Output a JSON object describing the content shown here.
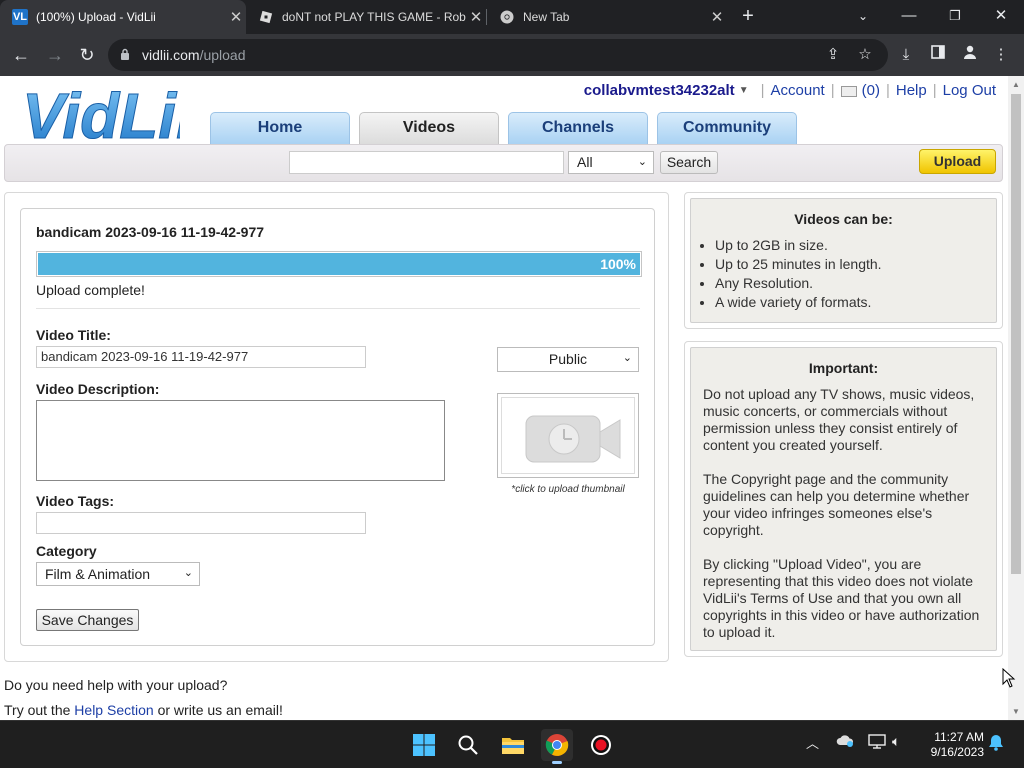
{
  "browser": {
    "tabs": [
      {
        "title": "(100%) Upload - VidLii",
        "favicon": "VL"
      },
      {
        "title": "doNT not PLAY THIS GAME - Rob",
        "favicon": "roblox-icon"
      },
      {
        "title": "New Tab",
        "favicon": "chrome-icon"
      }
    ],
    "url_domain": "vidlii.com",
    "url_path": "/upload"
  },
  "site": {
    "logo_text": "VidLii",
    "username": "collabvmtest34232alt",
    "account": "Account",
    "inbox_count": "(0)",
    "help": "Help",
    "logout": "Log Out",
    "nav": [
      "Home",
      "Videos",
      "Channels",
      "Community"
    ],
    "search_select": "All",
    "search_button": "Search",
    "upload_button": "Upload"
  },
  "upload": {
    "file_name": "bandicam 2023-09-16 11-19-42-977",
    "progress": 100,
    "progress_label": "100%",
    "status": "Upload complete!",
    "title_label": "Video Title:",
    "title_value": "bandicam 2023-09-16 11-19-42-977",
    "privacy": "Public",
    "description_label": "Video Description:",
    "thumbnail_hint": "*click to upload thumbnail",
    "tags_label": "Video Tags:",
    "category_label": "Category",
    "category_value": "Film & Animation",
    "save_button": "Save Changes"
  },
  "sidebar": {
    "videos_title": "Videos can be:",
    "videos_items": [
      "Up to 2GB in size.",
      "Up to 25 minutes in length.",
      "Any Resolution.",
      "A wide variety of formats."
    ],
    "important_title": "Important:",
    "important_paras": [
      "Do not upload any TV shows, music videos, music concerts, or commercials without permission unless they consist entirely of content you created yourself.",
      "The Copyright page and the community guidelines can help you determine whether your video infringes someones else's copyright.",
      "By clicking \"Upload Video\", you are representing that this video does not violate VidLii's Terms of Use and that you own all copyrights in this video or have authorization to upload it."
    ]
  },
  "footer": {
    "question": "Do you need help with your upload?",
    "try_prefix": "Try out the ",
    "help_link": "Help Section",
    "try_suffix": " or write us an email!"
  },
  "taskbar": {
    "time": "11:27 AM",
    "date": "9/16/2023"
  },
  "colors": {
    "progress": "#52b4de",
    "nav_tab": "#a9d2f3",
    "upload_btn": "#f5d000",
    "link": "#1d3fa6"
  }
}
